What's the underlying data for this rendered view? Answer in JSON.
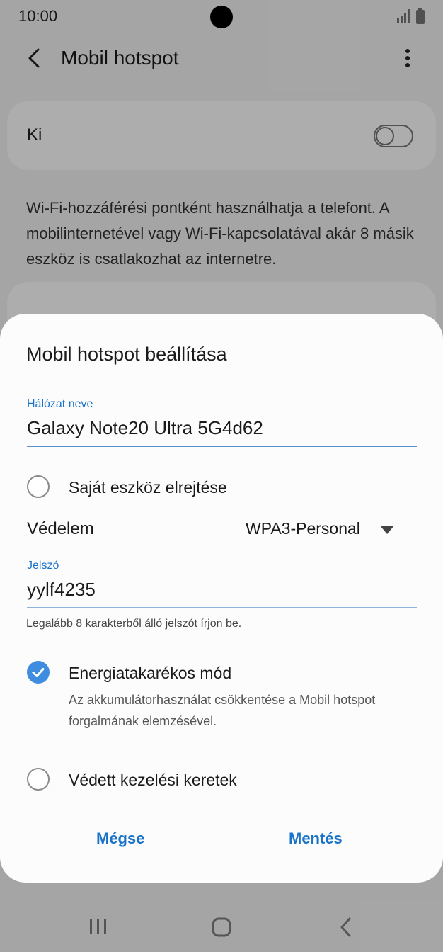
{
  "status_bar": {
    "time": "10:00"
  },
  "app_bar": {
    "title": "Mobil hotspot"
  },
  "toggle_card": {
    "label": "Ki"
  },
  "description": "Wi-Fi-hozzáférési pontként használhatja a telefont. A mobilinternetével vagy Wi-Fi-kapcsolatával akár 8 másik eszköz is csatlakozhat az internetre.",
  "dialog": {
    "title": "Mobil hotspot beállítása",
    "network_name": {
      "label": "Hálózat neve",
      "value": "Galaxy Note20 Ultra 5G4d62"
    },
    "hide_device": {
      "label": "Saját eszköz elrejtése",
      "checked": false
    },
    "security": {
      "label": "Védelem",
      "value": "WPA3-Personal"
    },
    "password": {
      "label": "Jelszó",
      "value": "yylf4235",
      "helper": "Legalább 8 karakterből álló jelszót írjon be."
    },
    "power_saving": {
      "label": "Energiatakarékos mód",
      "description": "Az akkumulátorhasználat csökkentése a Mobil hotspot forgalmának elemzésével.",
      "checked": true
    },
    "protected_frames": {
      "label": "Védett kezelési keretek",
      "checked": false
    },
    "cancel_label": "Mégse",
    "save_label": "Mentés"
  },
  "colors": {
    "accent": "#1a73c9",
    "checkbox": "#3e8de0"
  },
  "icons": {
    "back": "back-arrow-icon",
    "more": "more-vert-icon",
    "signal": "signal-icon",
    "battery": "battery-icon",
    "dropdown": "dropdown-triangle-icon",
    "check": "check-circle-icon",
    "nav_recents": "recents-icon",
    "nav_home": "home-icon",
    "nav_back": "nav-back-icon"
  }
}
